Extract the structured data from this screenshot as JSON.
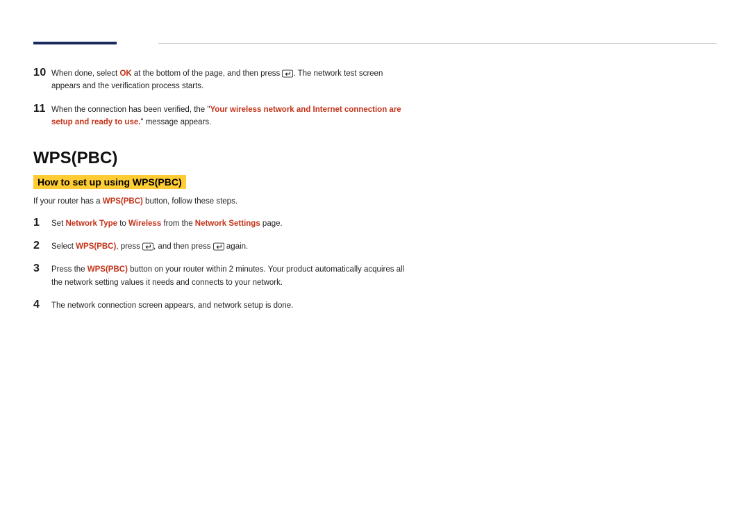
{
  "steps_a": [
    {
      "num": "10",
      "parts": [
        {
          "t": "text",
          "v": "When done, select "
        },
        {
          "t": "hl",
          "v": "OK"
        },
        {
          "t": "text",
          "v": " at the bottom of the page, and then press "
        },
        {
          "t": "icon",
          "v": "enter"
        },
        {
          "t": "text",
          "v": ". The network test screen appears and the verification process starts."
        }
      ]
    },
    {
      "num": "11",
      "parts": [
        {
          "t": "text",
          "v": "When the connection has been verified, the \""
        },
        {
          "t": "hl",
          "v": "Your wireless network and Internet connection are setup and ready to use."
        },
        {
          "t": "text",
          "v": "\" message appears."
        }
      ]
    }
  ],
  "heading1": "WPS(PBC)",
  "heading2": "How to set up using WPS(PBC)",
  "intro": [
    {
      "t": "text",
      "v": "If your router has a "
    },
    {
      "t": "hl",
      "v": "WPS(PBC)"
    },
    {
      "t": "text",
      "v": " button, follow these steps."
    }
  ],
  "steps_b": [
    {
      "num": "1",
      "parts": [
        {
          "t": "text",
          "v": "Set "
        },
        {
          "t": "hl",
          "v": "Network Type"
        },
        {
          "t": "text",
          "v": " to "
        },
        {
          "t": "hl",
          "v": "Wireless"
        },
        {
          "t": "text",
          "v": " from the "
        },
        {
          "t": "hl",
          "v": "Network Settings"
        },
        {
          "t": "text",
          "v": " page."
        }
      ]
    },
    {
      "num": "2",
      "parts": [
        {
          "t": "text",
          "v": "Select "
        },
        {
          "t": "hl",
          "v": "WPS(PBC)"
        },
        {
          "t": "text",
          "v": ", press "
        },
        {
          "t": "icon",
          "v": "enter"
        },
        {
          "t": "text",
          "v": ", and then press "
        },
        {
          "t": "icon",
          "v": "enter"
        },
        {
          "t": "text",
          "v": " again."
        }
      ]
    },
    {
      "num": "3",
      "parts": [
        {
          "t": "text",
          "v": "Press the "
        },
        {
          "t": "hl",
          "v": "WPS(PBC)"
        },
        {
          "t": "text",
          "v": " button on your router within 2 minutes. Your product automatically acquires all the network setting values it needs and connects to your network."
        }
      ]
    },
    {
      "num": "4",
      "parts": [
        {
          "t": "text",
          "v": "The network connection screen appears, and network setup is done."
        }
      ]
    }
  ]
}
